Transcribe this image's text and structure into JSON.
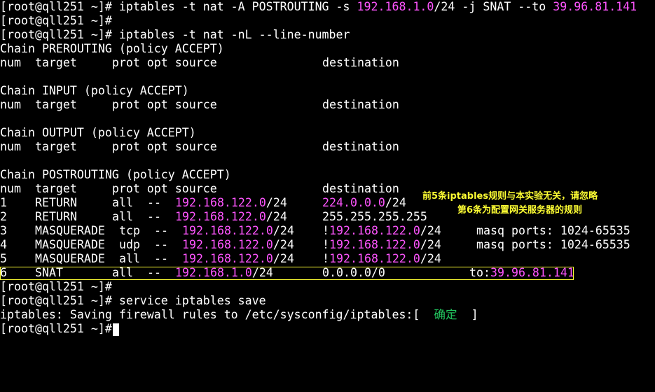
{
  "lines": {
    "l1": {
      "pre": "[root@qll251 ~]# iptables -t nat -A POSTROUTING -s ",
      "ip1": "192.168.1.0",
      "mid": "/24 -j SNAT --to ",
      "ip2": "39.96.81.141"
    },
    "l2": "[root@qll251 ~]#",
    "l3": "[root@qll251 ~]# iptables -t nat -nL --line-number",
    "chain_pre": "Chain PREROUTING (policy ACCEPT)",
    "chain_in": "Chain INPUT (policy ACCEPT)",
    "chain_out": "Chain OUTPUT (policy ACCEPT)",
    "chain_post": "Chain POSTROUTING (policy ACCEPT)",
    "header_a": "num  target     prot opt source",
    "header_b": "destination"
  },
  "rules": [
    {
      "num": "1",
      "target": "RETURN",
      "prot": "all",
      "opt": "--",
      "src_ip": "192.168.122.0",
      "src_mask": "/24",
      "dst_prefix": "",
      "dst_ip": "224.0.0.0",
      "dst_mask": "/24",
      "extra": ""
    },
    {
      "num": "2",
      "target": "RETURN",
      "prot": "all",
      "opt": "--",
      "src_ip": "192.168.122.0",
      "src_mask": "/24",
      "dst_prefix": "",
      "dst_ip": "255.255.255.255",
      "dst_mask": "",
      "extra": ""
    },
    {
      "num": "3",
      "target": "MASQUERADE",
      "prot": "tcp",
      "opt": "--",
      "src_ip": "192.168.122.0",
      "src_mask": "/24",
      "dst_prefix": "!",
      "dst_ip": "192.168.122.0",
      "dst_mask": "/24",
      "extra": "masq ports: 1024-65535"
    },
    {
      "num": "4",
      "target": "MASQUERADE",
      "prot": "udp",
      "opt": "--",
      "src_ip": "192.168.122.0",
      "src_mask": "/24",
      "dst_prefix": "!",
      "dst_ip": "192.168.122.0",
      "dst_mask": "/24",
      "extra": "masq ports: 1024-65535"
    },
    {
      "num": "5",
      "target": "MASQUERADE",
      "prot": "all",
      "opt": "--",
      "src_ip": "192.168.122.0",
      "src_mask": "/24",
      "dst_prefix": "!",
      "dst_ip": "192.168.122.0",
      "dst_mask": "/24",
      "extra": ""
    },
    {
      "num": "6",
      "target": "SNAT",
      "prot": "all",
      "opt": "--",
      "src_ip": "192.168.1.0",
      "src_mask": "/24",
      "dst_prefix": "",
      "dst_ip": "0.0.0.0/0",
      "dst_mask": "",
      "extra_label": "to:",
      "extra_ip": "39.96.81.141"
    }
  ],
  "after": {
    "p1": "[root@qll251 ~]#",
    "p2": "[root@qll251 ~]# service iptables save",
    "save_pre": "iptables: Saving firewall rules to /etc/sysconfig/iptables:[  ",
    "ok": "确定",
    "save_post": "  ]",
    "p3": "[root@qll251 ~]#"
  },
  "annotations": {
    "note1": "前5条iptables规则与本实验无关，请忽略",
    "note2": "第6条为配置网关服务器的规则"
  },
  "colors": {
    "prompt_text": "#ffffff",
    "ip_highlight": "#ff55ff",
    "ok_text": "#22c55e",
    "annotation": "#ffff33",
    "background": "#000000"
  }
}
